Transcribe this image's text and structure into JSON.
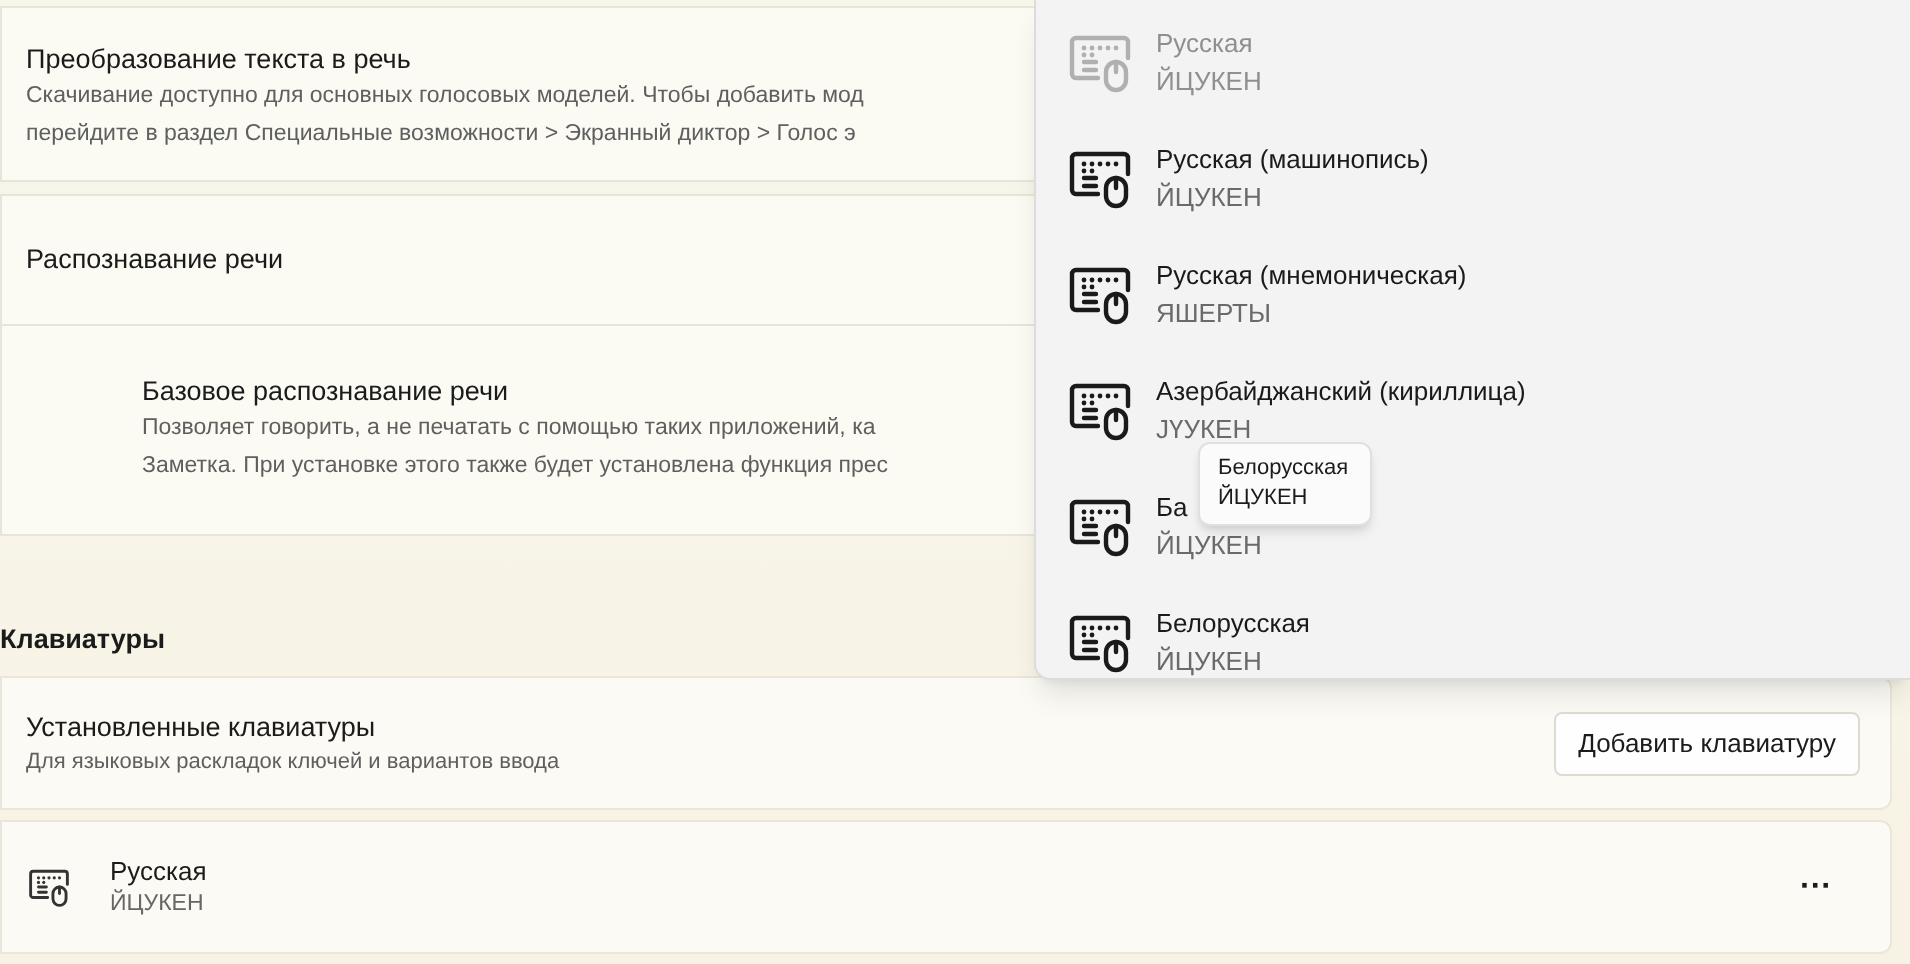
{
  "speech_cards": [
    {
      "title": "Преобразование текста в речь",
      "description_lines": [
        "Скачивание доступно для основных голосовых моделей. Чтобы добавить мод",
        "перейдите в раздел Специальные возможности > Экранный диктор > Голос э"
      ]
    },
    {
      "title": "Распознавание речи"
    },
    {
      "title": "Базовое распознавание речи",
      "description_lines": [
        "Позволяет говорить, а не печатать с помощью таких приложений, ка",
        "Заметка. При установке этого также будет установлена функция прес"
      ]
    }
  ],
  "keyboards_section": {
    "heading": "Клавиатуры",
    "installed": {
      "title": "Установленные клавиатуры",
      "description": "Для языковых раскладок ключей и вариантов ввода",
      "button": "Добавить клавиатуру"
    },
    "keyboards": [
      {
        "name": "Русская",
        "layout": "ЙЦУКЕН",
        "more": "···"
      }
    ]
  },
  "dropdown": {
    "items": [
      {
        "name": "Русская",
        "layout": "ЙЦУКЕН",
        "disabled": true
      },
      {
        "name": "Русская (машинопись)",
        "layout": "ЙЦУКЕН",
        "disabled": false
      },
      {
        "name": "Русская (мнемоническая)",
        "layout": "ЯШЕРТЫ",
        "disabled": false
      },
      {
        "name": "Азербайджанский (кириллица)",
        "layout": "JҮУКЕН",
        "disabled": false
      },
      {
        "name": "Ба",
        "layout": "ЙЦУКЕН",
        "disabled": false
      },
      {
        "name": "Белорусская",
        "layout": "ЙЦУКЕН",
        "disabled": false
      }
    ]
  },
  "tooltip": {
    "lines": [
      "Белорусская",
      "ЙЦУКЕН"
    ]
  }
}
